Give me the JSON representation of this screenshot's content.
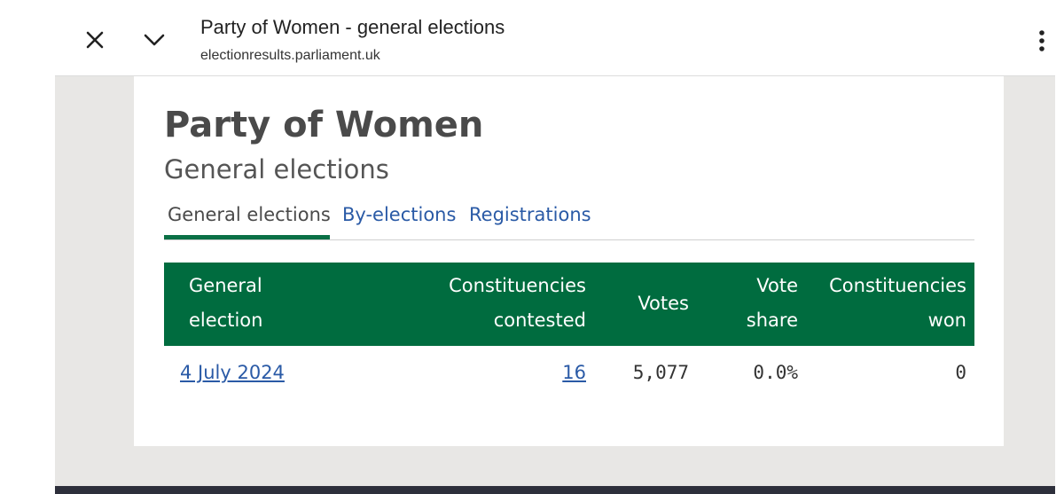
{
  "browser": {
    "page_title": "Party of Women - general elections",
    "url": "electionresults.parliament.uk",
    "close_icon": "close-icon",
    "collapse_icon": "chevron-down-icon",
    "menu_icon": "more-vert-icon"
  },
  "page": {
    "party_name": "Party of Women",
    "subtitle": "General elections"
  },
  "tabs": [
    {
      "label": "General elections",
      "active": true
    },
    {
      "label": "By-elections",
      "active": false
    },
    {
      "label": "Registrations",
      "active": false
    }
  ],
  "table": {
    "headers": {
      "general_election_1": "General",
      "general_election_2": "election",
      "contested_1": "Constituencies",
      "contested_2": "contested",
      "votes": "Votes",
      "vote_share_1": "Vote",
      "vote_share_2": "share",
      "won_1": "Constituencies",
      "won_2": "won"
    },
    "rows": [
      {
        "general_election": "4 July 2024",
        "constituencies_contested": "16",
        "votes": "5,077",
        "vote_share": "0.0%",
        "constituencies_won": "0"
      }
    ]
  },
  "colors": {
    "header_green": "#006c3f",
    "link_blue": "#2a5aa6",
    "tab_underline": "#0a7046"
  }
}
